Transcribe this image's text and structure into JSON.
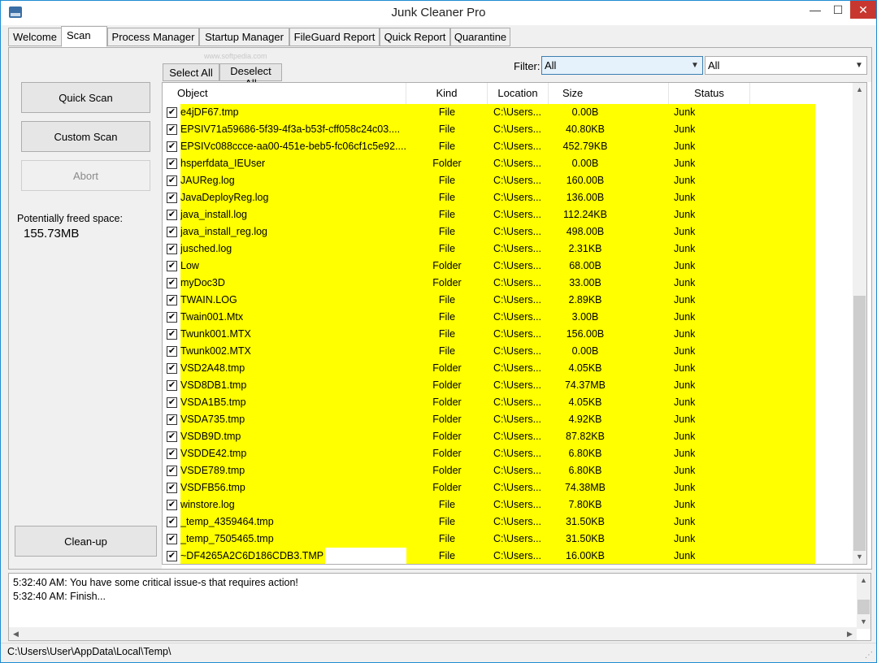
{
  "window": {
    "title": "Junk Cleaner Pro",
    "min": "—",
    "max": "☐",
    "close": "✕"
  },
  "tabs": [
    "Welcome",
    "Scan",
    "Process Manager",
    "Startup Manager",
    "FileGuard Report",
    "Quick Report",
    "Quarantine"
  ],
  "active_tab": "Scan",
  "left": {
    "quick_scan": "Quick Scan",
    "custom_scan": "Custom Scan",
    "abort": "Abort",
    "freed_label": "Potentially freed space:",
    "freed_value": "155.73MB",
    "cleanup": "Clean-up"
  },
  "toolbar": {
    "select_all": "Select All",
    "deselect_all": "Deselect All",
    "filter_label": "Filter:",
    "filter1_value": "All",
    "filter2_value": "All",
    "watermark": "www.softpedia.com"
  },
  "columns": {
    "object": "Object",
    "kind": "Kind",
    "location": "Location",
    "size": "Size",
    "status": "Status"
  },
  "rows": [
    {
      "object": "e4jDF67.tmp",
      "kind": "File",
      "location": "C:\\Users...",
      "size": "0.00B",
      "status": "Junk"
    },
    {
      "object": "EPSIV71a59686-5f39-4f3a-b53f-cff058c24c03....",
      "kind": "File",
      "location": "C:\\Users...",
      "size": "40.80KB",
      "status": "Junk"
    },
    {
      "object": "EPSIVc088ccce-aa00-451e-beb5-fc06cf1c5e92....",
      "kind": "File",
      "location": "C:\\Users...",
      "size": "452.79KB",
      "status": "Junk"
    },
    {
      "object": "hsperfdata_IEUser",
      "kind": "Folder",
      "location": "C:\\Users...",
      "size": "0.00B",
      "status": "Junk"
    },
    {
      "object": "JAUReg.log",
      "kind": "File",
      "location": "C:\\Users...",
      "size": "160.00B",
      "status": "Junk"
    },
    {
      "object": "JavaDeployReg.log",
      "kind": "File",
      "location": "C:\\Users...",
      "size": "136.00B",
      "status": "Junk"
    },
    {
      "object": "java_install.log",
      "kind": "File",
      "location": "C:\\Users...",
      "size": "112.24KB",
      "status": "Junk"
    },
    {
      "object": "java_install_reg.log",
      "kind": "File",
      "location": "C:\\Users...",
      "size": "498.00B",
      "status": "Junk"
    },
    {
      "object": "jusched.log",
      "kind": "File",
      "location": "C:\\Users...",
      "size": "2.31KB",
      "status": "Junk"
    },
    {
      "object": "Low",
      "kind": "Folder",
      "location": "C:\\Users...",
      "size": "68.00B",
      "status": "Junk"
    },
    {
      "object": "myDoc3D",
      "kind": "Folder",
      "location": "C:\\Users...",
      "size": "33.00B",
      "status": "Junk"
    },
    {
      "object": "TWAIN.LOG",
      "kind": "File",
      "location": "C:\\Users...",
      "size": "2.89KB",
      "status": "Junk"
    },
    {
      "object": "Twain001.Mtx",
      "kind": "File",
      "location": "C:\\Users...",
      "size": "3.00B",
      "status": "Junk"
    },
    {
      "object": "Twunk001.MTX",
      "kind": "File",
      "location": "C:\\Users...",
      "size": "156.00B",
      "status": "Junk"
    },
    {
      "object": "Twunk002.MTX",
      "kind": "File",
      "location": "C:\\Users...",
      "size": "0.00B",
      "status": "Junk"
    },
    {
      "object": "VSD2A48.tmp",
      "kind": "Folder",
      "location": "C:\\Users...",
      "size": "4.05KB",
      "status": "Junk"
    },
    {
      "object": "VSD8DB1.tmp",
      "kind": "Folder",
      "location": "C:\\Users...",
      "size": "74.37MB",
      "status": "Junk"
    },
    {
      "object": "VSDA1B5.tmp",
      "kind": "Folder",
      "location": "C:\\Users...",
      "size": "4.05KB",
      "status": "Junk"
    },
    {
      "object": "VSDA735.tmp",
      "kind": "Folder",
      "location": "C:\\Users...",
      "size": "4.92KB",
      "status": "Junk"
    },
    {
      "object": "VSDB9D.tmp",
      "kind": "Folder",
      "location": "C:\\Users...",
      "size": "87.82KB",
      "status": "Junk"
    },
    {
      "object": "VSDDE42.tmp",
      "kind": "Folder",
      "location": "C:\\Users...",
      "size": "6.80KB",
      "status": "Junk"
    },
    {
      "object": "VSDE789.tmp",
      "kind": "Folder",
      "location": "C:\\Users...",
      "size": "6.80KB",
      "status": "Junk"
    },
    {
      "object": "VSDFB56.tmp",
      "kind": "Folder",
      "location": "C:\\Users...",
      "size": "74.38MB",
      "status": "Junk"
    },
    {
      "object": "winstore.log",
      "kind": "File",
      "location": "C:\\Users...",
      "size": "7.80KB",
      "status": "Junk"
    },
    {
      "object": "_temp_4359464.tmp",
      "kind": "File",
      "location": "C:\\Users...",
      "size": "31.50KB",
      "status": "Junk"
    },
    {
      "object": "_temp_7505465.tmp",
      "kind": "File",
      "location": "C:\\Users...",
      "size": "31.50KB",
      "status": "Junk"
    },
    {
      "object": "~DF4265A2C6D186CDB3.TMP",
      "kind": "File",
      "location": "C:\\Users...",
      "size": "16.00KB",
      "status": "Junk"
    }
  ],
  "highlight_color": "#ffff00",
  "log": [
    "5:32:40 AM: You have some critical issue-s that requires action!",
    "5:32:40 AM: Finish..."
  ],
  "statusbar": "C:\\Users\\User\\AppData\\Local\\Temp\\"
}
